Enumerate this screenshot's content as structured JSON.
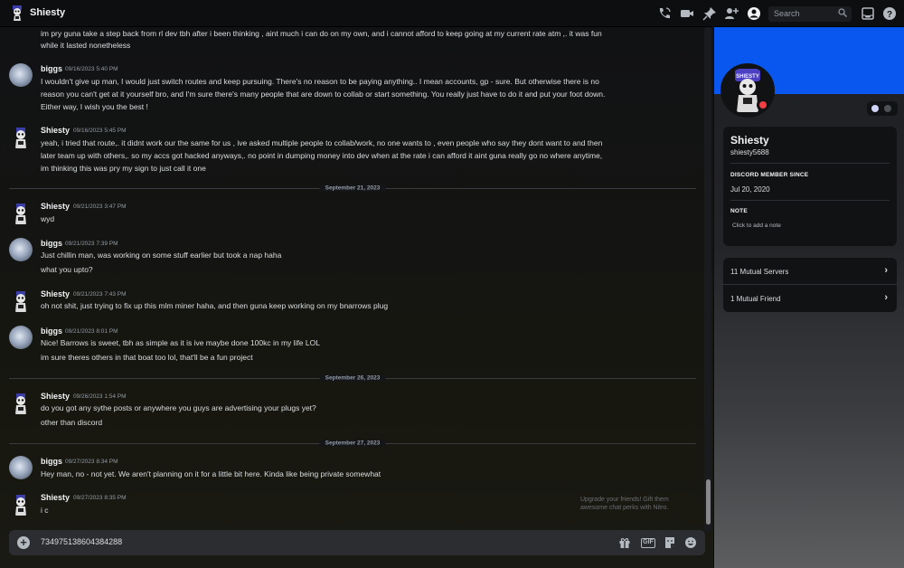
{
  "window": {
    "title": "Shiesty",
    "search_placeholder": "Search"
  },
  "icons": {
    "call": "phone-call-icon",
    "video": "video-icon",
    "pin": "pin-icon",
    "add_friend": "add-friend-icon",
    "profile": "profile-icon",
    "inbox": "inbox-icon",
    "help": "help-icon"
  },
  "messages": [
    {
      "author": "",
      "time": "",
      "lines": [
        "im pry guna take a step back from rl dev tbh after i been thinking ,  aint much i can do on my own, and i cannot afford to keep going at my current rate atm ,.  it was fun",
        "while it lasted nonetheless"
      ]
    },
    {
      "author": "biggs",
      "time": "09/16/2023 5:40 PM",
      "lines": [
        "I wouldn't give up man, I would just switch routes and keep pursuing. There's no reason to be paying anything.. I mean accounts, gp - sure. But otherwise there is no",
        "reason you can't get at it yourself bro, and I'm sure there's many people that are down to collab or start something. You really just have to do it and put your foot down.",
        "Either way, I wish you the best !"
      ]
    },
    {
      "author": "Shiesty",
      "time": "09/16/2023 5:45 PM",
      "lines": [
        "yeah, i tried that route,. it didnt work our the same for us , ive asked multiple people to collab/work, no one wants to , even people who say they dont want to and then",
        "later team up with others,. so my accs got hacked anyways,. no point in dumping money into dev when at the rate i can afford it aint guna really go no where anytime,",
        "im thinking this was pry my sign to just call it one"
      ]
    },
    {
      "author": "Shiesty",
      "time": "09/21/2023 3:47 PM",
      "lines": [
        "wyd"
      ]
    },
    {
      "author": "biggs",
      "time": "09/21/2023 7:39 PM",
      "lines": [
        "Just chillin man, was working on some stuff earlier but took a nap haha",
        "what you upto?"
      ]
    },
    {
      "author": "Shiesty",
      "time": "09/21/2023 7:43 PM",
      "lines": [
        "oh not shit, just trying to fix up this mlm miner haha, and then guna keep working on my bnarrows plug"
      ]
    },
    {
      "author": "biggs",
      "time": "09/21/2023 8:01 PM",
      "lines": [
        "Nice! Barrows is sweet, tbh as simple as it is ive maybe done 100kc in my life LOL",
        "im sure theres others in that boat too lol, that'll be a fun project"
      ]
    },
    {
      "author": "Shiesty",
      "time": "09/26/2023 1:54 PM",
      "lines": [
        "do you got any sythe posts or anywhere you guys are advertising your plugs yet?",
        "other than discord"
      ]
    },
    {
      "author": "biggs",
      "time": "09/27/2023 8:34 PM",
      "lines": [
        "Hey man, no - not yet. We aren't planning on it for a little bit here. Kinda like being private somewhat"
      ]
    },
    {
      "author": "Shiesty",
      "time": "09/27/2023 8:35 PM",
      "lines": [
        "i c"
      ]
    }
  ],
  "dividers": [
    "September 21, 2023",
    "September 26, 2023",
    "September 27, 2023"
  ],
  "composer": {
    "value": "734975138604384288",
    "gif_label": "GIF",
    "nitro_hint": "Upgrade your friends! Gift them awesome chat perks with Nitro."
  },
  "profile": {
    "display_name": "Shiesty",
    "username": "shiesty5688",
    "member_since_label": "DISCORD MEMBER SINCE",
    "member_since": "Jul 20, 2020",
    "note_label": "NOTE",
    "note_placeholder": "Click to add a note",
    "mutual_servers": "11 Mutual Servers",
    "mutual_friends": "1 Mutual Friend",
    "banner_color": "#0a57f0",
    "status_color": "#f23f43"
  }
}
